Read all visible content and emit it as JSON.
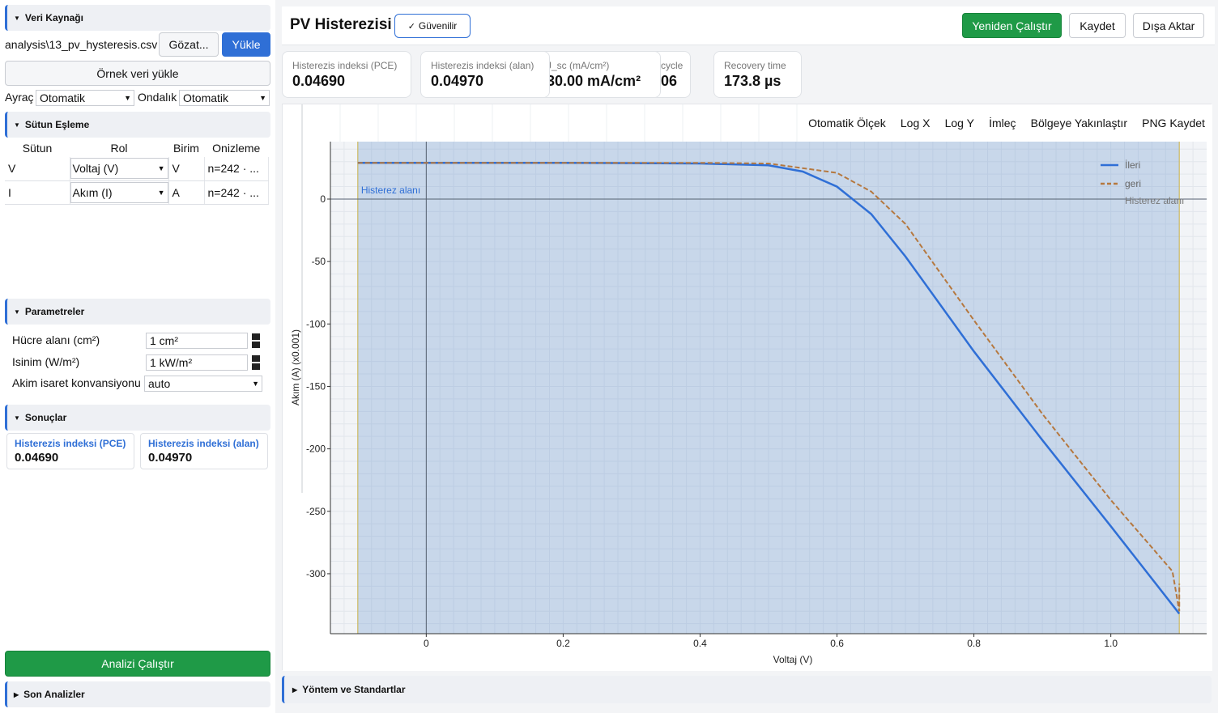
{
  "left": {
    "data_source": {
      "title": "Veri Kaynağı",
      "file_path": "analysis\\13_pv_hysteresis.csv",
      "browse": "Gözat...",
      "load": "Yükle",
      "sample": "Örnek veri yükle",
      "separator_label": "Ayraç",
      "separator_value": "Otomatik",
      "decimal_label": "Ondalık",
      "decimal_value": "Otomatik"
    },
    "column_mapping": {
      "title": "Sütun Eşleme",
      "headers": [
        "Sütun",
        "Rol",
        "Birim",
        "Onizleme"
      ],
      "rows": [
        {
          "column": "V",
          "role": "Voltaj (V)",
          "unit": "V",
          "preview": "n=242 · ..."
        },
        {
          "column": "I",
          "role": "Akım (I)",
          "unit": "A",
          "preview": "n=242 · ..."
        }
      ]
    },
    "parameters": {
      "title": "Parametreler",
      "cell_area_label": "Hücre alanı (cm²)",
      "cell_area_value": "1 cm²",
      "irradiance_label": "Isinim (W/m²)",
      "irradiance_value": "1 kW/m²",
      "sign_label": "Akim isaret konvansiyonu",
      "sign_value": "auto"
    },
    "results": {
      "title": "Sonuçlar",
      "cards": [
        {
          "label": "Histerezis indeksi (PCE)",
          "value": "0.04690"
        },
        {
          "label": "Histerezis indeksi (alan)",
          "value": "0.04970"
        }
      ]
    },
    "run_button": "Analizi Çalıştır",
    "recent_title": "Son Analizler"
  },
  "header": {
    "title": "PV Histerezisi",
    "badge": "Güvenilir",
    "rerun": "Yeniden Çalıştır",
    "save": "Kaydet",
    "export": "Dışa Aktar"
  },
  "metrics": [
    {
      "label": "Histerezis indeksi (PCE)",
      "value": "0.04690"
    },
    {
      "label": "Histerezis indeksi (alan)",
      "value": "0.04970"
    },
    {
      "label": "J_sc (mA/cm²)",
      "value": "30.00 mA/cm²"
    },
    {
      "label": "cycle",
      "value": "06"
    },
    {
      "label": "Recovery time",
      "value": "173.8 µs"
    }
  ],
  "toolbar": [
    "Otomatik Ölçek",
    "Log X",
    "Log Y",
    "İmleç",
    "Bölgeye Yakınlaştır",
    "PNG Kaydet"
  ],
  "chart_data": {
    "type": "line",
    "xlabel": "Voltaj (V)",
    "ylabel": "Akım (A) (x0.001)",
    "xlim": [
      -0.14,
      1.14
    ],
    "ylim": [
      -348,
      46
    ],
    "xticks": [
      0,
      0.2,
      0.4,
      0.6,
      0.8,
      1.0
    ],
    "xtick_labels": [
      "0",
      "0.2",
      "0.4",
      "0.6",
      "0.8",
      "1.0"
    ],
    "yticks": [
      0,
      -50,
      -100,
      -150,
      -200,
      -250,
      -300
    ],
    "shaded_region": {
      "label": "Histerez alanı",
      "x_range": [
        -0.1,
        1.1
      ]
    },
    "legend": {
      "position": "top-right",
      "extra_label": "Histerez alanı"
    },
    "series": [
      {
        "name": "İleri",
        "color": "#2f6fd6",
        "style": "solid",
        "x": [
          -0.1,
          0.0,
          0.2,
          0.4,
          0.5,
          0.55,
          0.6,
          0.65,
          0.7,
          0.8,
          0.9,
          1.0,
          1.1
        ],
        "y": [
          29,
          29,
          29,
          28.5,
          27,
          22,
          10,
          -12,
          -46,
          -122,
          -193,
          -262,
          -332
        ]
      },
      {
        "name": "geri",
        "color": "#b5783f",
        "style": "dashed",
        "x": [
          -0.1,
          0.0,
          0.2,
          0.4,
          0.5,
          0.6,
          0.65,
          0.7,
          0.8,
          0.9,
          1.0,
          1.09,
          1.1,
          1.1
        ],
        "y": [
          29,
          29,
          29,
          29,
          28.5,
          21,
          6,
          -20,
          -97,
          -172,
          -241,
          -298,
          -330,
          -308
        ]
      }
    ]
  }
}
